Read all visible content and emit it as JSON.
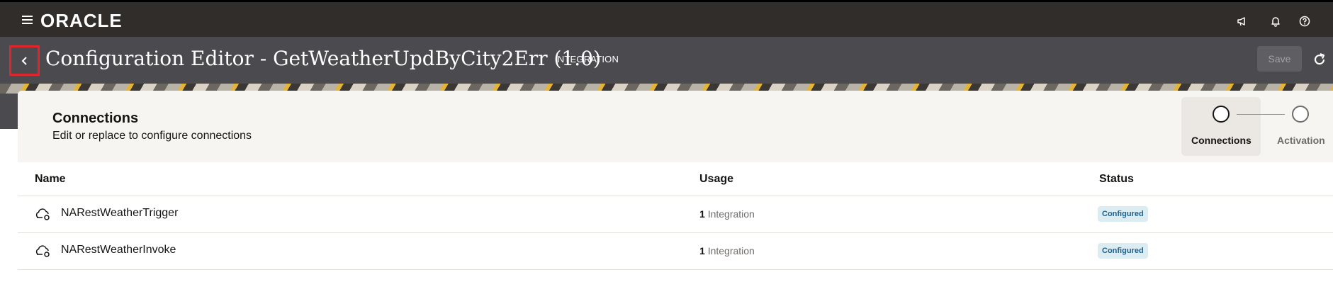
{
  "topbar": {
    "logo": "ORACLE",
    "menu_icon": "hamburger-menu-icon",
    "announcements_icon": "megaphone-icon",
    "notifications_icon": "bell-icon",
    "help_icon": "help-icon"
  },
  "titlebar": {
    "back_icon": "chevron-left-icon",
    "title": "Configuration Editor - GetWeatherUpdByCity2Err (1.0)",
    "type_tag": "INTEGRATION",
    "save_label": "Save",
    "refresh_icon": "refresh-icon"
  },
  "section": {
    "title": "Connections",
    "subtitle": "Edit or replace to configure connections"
  },
  "steps": [
    {
      "label": "Connections",
      "active": true
    },
    {
      "label": "Activation",
      "active": false
    }
  ],
  "table": {
    "columns": [
      "Name",
      "Usage",
      "Status"
    ],
    "rows": [
      {
        "icon": "cloud-connection-icon",
        "name": "NARestWeatherTrigger",
        "usage_count": "1",
        "usage_label": "Integration",
        "status": "Configured"
      },
      {
        "icon": "cloud-connection-icon",
        "name": "NARestWeatherInvoke",
        "usage_count": "1",
        "usage_label": "Integration",
        "status": "Configured"
      }
    ]
  },
  "colors": {
    "topbar": "#312d2a",
    "titlebar": "#4b4a4f",
    "highlight": "#e0262c",
    "badge_bg": "#dcecf3",
    "badge_text": "#22618a"
  }
}
